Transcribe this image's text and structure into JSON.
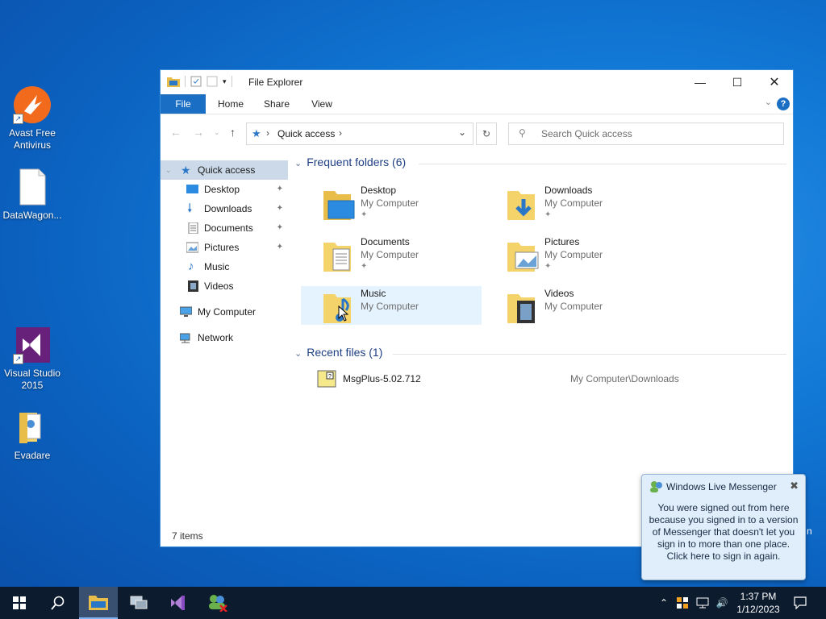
{
  "desktop": {
    "icons": [
      {
        "label": "Avast Free Antivirus"
      },
      {
        "label": "DataWagon..."
      },
      {
        "label": "Visual Studio 2015"
      },
      {
        "label": "Evadare"
      }
    ],
    "peek_text": "n"
  },
  "window": {
    "title": "File Explorer",
    "tabs": [
      "File",
      "Home",
      "Share",
      "View"
    ],
    "help_label": "?",
    "address": {
      "crumb": "Quick access"
    },
    "search": {
      "placeholder": "Search Quick access"
    },
    "nav": [
      {
        "label": "Quick access",
        "selected": true
      },
      {
        "label": "Desktop",
        "pinned": true
      },
      {
        "label": "Downloads",
        "pinned": true
      },
      {
        "label": "Documents",
        "pinned": true
      },
      {
        "label": "Pictures",
        "pinned": true
      },
      {
        "label": "Music"
      },
      {
        "label": "Videos"
      },
      {
        "label": "My Computer"
      },
      {
        "label": "Network"
      }
    ],
    "frequent": {
      "header": "Frequent folders (6)",
      "items": [
        {
          "name": "Desktop",
          "location": "My Computer",
          "pinned": true
        },
        {
          "name": "Downloads",
          "location": "My Computer",
          "pinned": true
        },
        {
          "name": "Documents",
          "location": "My Computer",
          "pinned": true
        },
        {
          "name": "Pictures",
          "location": "My Computer",
          "pinned": true
        },
        {
          "name": "Music",
          "location": "My Computer"
        },
        {
          "name": "Videos",
          "location": "My Computer"
        }
      ]
    },
    "recent": {
      "header": "Recent files (1)",
      "items": [
        {
          "name": "MsgPlus-5.02.712",
          "path": "My Computer\\Downloads"
        }
      ]
    },
    "status": "7 items"
  },
  "notification": {
    "title": "Windows Live Messenger",
    "body": "You were signed out from here because you signed in to a version of Messenger that doesn't let you sign in to more than one place. Click here to sign in again."
  },
  "taskbar": {
    "time": "1:37 PM",
    "date": "1/12/2023"
  },
  "colors": {
    "accent": "#1a6fc4",
    "desktop": "#1279d6",
    "taskbar": "#0c1b2d",
    "folder": "#f5d36b"
  }
}
